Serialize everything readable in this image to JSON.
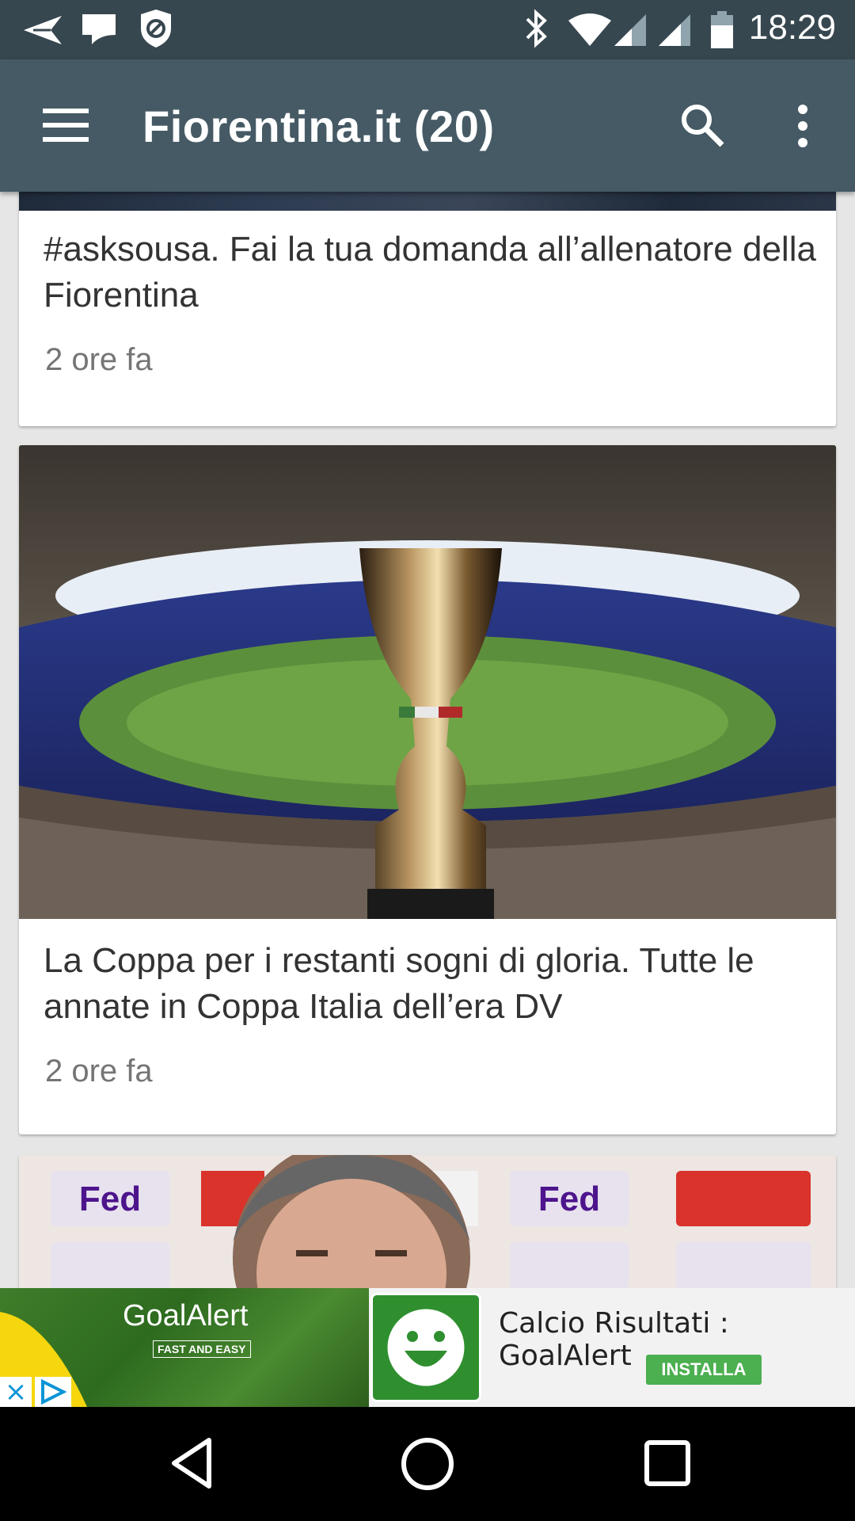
{
  "status_bar": {
    "time": "18:29",
    "icons": [
      "send-icon",
      "notification-icon",
      "shield-icon",
      "bluetooth-icon",
      "wifi-icon",
      "signal-icon",
      "signal-icon",
      "battery-icon"
    ]
  },
  "app_bar": {
    "title": "Fiorentina.it (20)",
    "icons": [
      "menu-icon",
      "search-icon",
      "more-vert-icon"
    ]
  },
  "articles": [
    {
      "title": "#asksousa. Fai la tua domanda all’allenatore della Fiorentina",
      "time": "2 ore fa"
    },
    {
      "title": "La Coppa per i restanti sogni di gloria. Tutte le annate in Coppa Italia dell’era DV",
      "time": "2 ore fa"
    }
  ],
  "ad": {
    "brand": "GoalAlert",
    "tagline": "FAST AND EASY",
    "app_name": "Calcio Risultati : GoalAlert",
    "install_label": "INSTALLA",
    "close_label": "×"
  },
  "colors": {
    "status_bar": "#37474f",
    "app_bar": "#455a64",
    "install_button": "#4caf50"
  }
}
